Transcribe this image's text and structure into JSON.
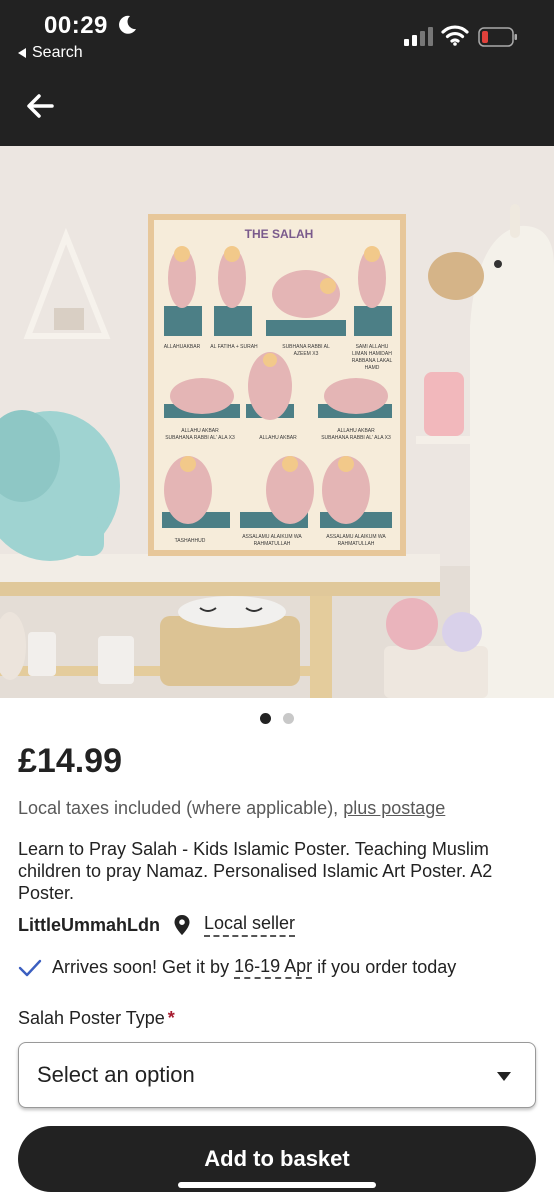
{
  "status_bar": {
    "time": "00:29",
    "back_app_label": "Search"
  },
  "product": {
    "image": {
      "poster_title": "THE SALAH",
      "captions": [
        "ALLAHUAKBAR",
        "AL FATIHA + SURAH",
        "SUBHANA RABBI AL",
        "AZEEM X3",
        "SAMI ALLAHU",
        "LIMAN HAMIDAH",
        "RABBANA LAKAL",
        "HAMD",
        "ALLAHU AKBAR",
        "SUBAHANA RABBI AL' ALA X3",
        "ALLAHU AKBAR",
        "ALLAHU AKBAR",
        "SUBAHANA RABBI AL' ALA X3",
        "TASHAHHUD",
        "ASSALAMU ALAIKUM WA",
        "RAHMATULLAH",
        "ASSALAMU ALAIKUM WA",
        "RAHMATULLAH"
      ],
      "page_count": 2,
      "current_page": 1
    },
    "price": "£14.99",
    "taxes_text": "Local taxes included (where applicable),",
    "postage_link": "plus postage",
    "title": "Learn to Pray Salah - Kids Islamic Poster. Teaching Muslim children to pray Namaz. Personalised Islamic Art Poster. A2 Poster.",
    "seller_name": "LittleUmmahLdn",
    "seller_badge": "Local seller",
    "delivery": {
      "prefix": "Arrives soon! Get it by",
      "dates": "16-19 Apr",
      "suffix": "if you order today"
    },
    "option": {
      "label": "Salah Poster Type",
      "required_mark": "*",
      "placeholder": "Select an option"
    },
    "add_button": "Add to basket"
  },
  "colors": {
    "header_bg": "#222222",
    "poster_bg": "#f4ead8",
    "figure_pink": "#e4b5b5",
    "mat_teal": "#4c7f86",
    "required_red": "#a61a2e"
  },
  "icons": [
    "moon-icon",
    "back-triangle-icon",
    "signal-icon",
    "wifi-icon",
    "battery-icon",
    "back-arrow-icon",
    "location-pin-icon",
    "checkmark-icon",
    "chevron-down-icon"
  ]
}
